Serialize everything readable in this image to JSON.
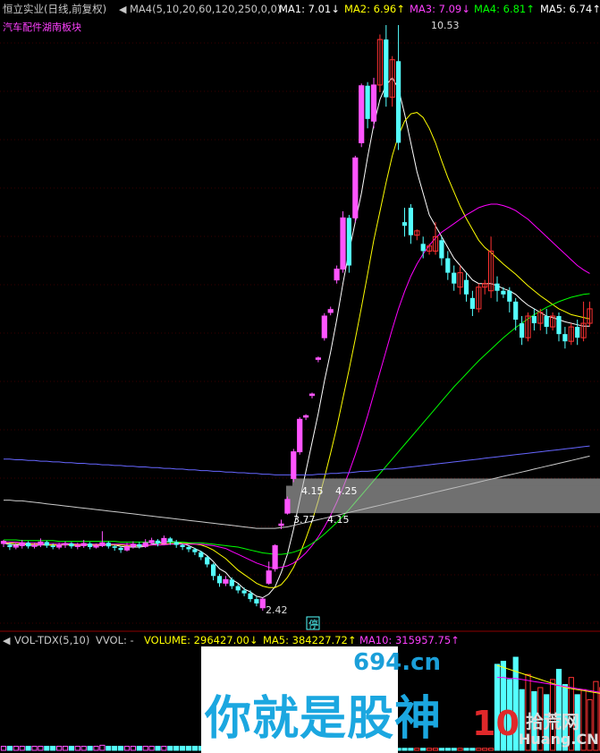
{
  "header": {
    "stock_name": "恒立实业(日线,前复权)",
    "ma_label": "MA4(5,10,20,60,120,250,0,0)",
    "ma1": "MA1: 7.01↓",
    "ma2": "MA2: 6.96↑",
    "ma3": "MA3: 7.09↓",
    "ma4": "MA4: 6.81↑",
    "ma5": "MA5: 6.74↑",
    "sector": "汽车配件湖南板块"
  },
  "annotations": {
    "high": "10.53",
    "low": "2.42",
    "gap1_left": "4.15",
    "gap1_right": "4.25",
    "gap2_left": "3.77",
    "gap2_right": "4.15",
    "halt": "停"
  },
  "volume_header": {
    "name": "VOL-TDX(5,10)",
    "vvol": "VVOL: -",
    "volume": "VOLUME: 296427.00↓",
    "ma5": "MA5: 384227.72↑",
    "ma10": "MA10: 315957.75↑"
  },
  "watermark": {
    "site1": "694.cn",
    "slogan": "你就是股神",
    "site2_num": "10",
    "site2_cn": "拾荒网",
    "site2_en": "Huang.CN"
  },
  "colors": {
    "up": "#ff55ff",
    "up_red": "#ff3232",
    "down": "#54ffff",
    "ma1": "#ffffff",
    "ma2": "#ffff00",
    "ma3": "#ff00ff",
    "ma4": "#00ff00",
    "ma5": "#6666ff",
    "ma6": "#cccccc",
    "header_title": "#c8c8c8",
    "header_ma1": "#ffffff",
    "header_ma2": "#ffff00",
    "header_ma3": "#ff40ff",
    "header_ma4": "#00ff00",
    "header_ma5": "#ffffff"
  },
  "chart_data": {
    "type": "candlestick",
    "price_axis": {
      "min": 2.42,
      "max": 10.53,
      "scale": "linear"
    },
    "extremes": {
      "high": 10.53,
      "low": 2.42
    },
    "gaps": [
      {
        "from": 4.15,
        "to": 4.25
      },
      {
        "from": 3.77,
        "to": 4.15
      }
    ],
    "candles": [
      [
        3.35,
        3.38,
        3.3,
        3.4
      ],
      [
        3.33,
        3.3,
        3.26,
        3.36
      ],
      [
        3.3,
        3.32,
        3.27,
        3.36
      ],
      [
        3.32,
        3.36,
        3.28,
        3.4
      ],
      [
        3.36,
        3.31,
        3.28,
        3.38
      ],
      [
        3.31,
        3.33,
        3.28,
        3.36
      ],
      [
        3.33,
        3.37,
        3.3,
        3.42
      ],
      [
        3.37,
        3.32,
        3.29,
        3.39
      ],
      [
        3.32,
        3.3,
        3.27,
        3.35
      ],
      [
        3.3,
        3.33,
        3.27,
        3.36
      ],
      [
        3.33,
        3.35,
        3.29,
        3.38
      ],
      [
        3.35,
        3.31,
        3.28,
        3.37
      ],
      [
        3.31,
        3.32,
        3.27,
        3.36
      ],
      [
        3.32,
        3.35,
        3.29,
        3.4
      ],
      [
        3.35,
        3.3,
        3.27,
        3.37
      ],
      [
        3.3,
        3.32,
        3.28,
        3.35
      ],
      [
        3.32,
        3.36,
        3.3,
        3.52
      ],
      [
        3.36,
        3.31,
        3.28,
        3.38
      ],
      [
        3.31,
        3.29,
        3.25,
        3.33
      ],
      [
        3.29,
        3.26,
        3.22,
        3.31
      ],
      [
        3.26,
        3.31,
        3.24,
        3.36
      ],
      [
        3.31,
        3.34,
        3.28,
        3.38
      ],
      [
        3.34,
        3.31,
        3.28,
        3.37
      ],
      [
        3.31,
        3.36,
        3.29,
        3.41
      ],
      [
        3.36,
        3.39,
        3.33,
        3.43
      ],
      [
        3.39,
        3.35,
        3.31,
        3.41
      ],
      [
        3.35,
        3.42,
        3.33,
        3.46
      ],
      [
        3.42,
        3.37,
        3.33,
        3.44
      ],
      [
        3.37,
        3.33,
        3.29,
        3.4
      ],
      [
        3.33,
        3.3,
        3.26,
        3.35
      ],
      [
        3.3,
        3.27,
        3.23,
        3.32
      ],
      [
        3.27,
        3.23,
        3.19,
        3.29
      ],
      [
        3.23,
        3.16,
        3.12,
        3.25
      ],
      [
        3.16,
        3.06,
        3.02,
        3.18
      ],
      [
        3.06,
        2.9,
        2.84,
        3.08
      ],
      [
        2.9,
        2.8,
        2.75,
        2.93
      ],
      [
        2.8,
        2.85,
        2.76,
        2.9
      ],
      [
        2.85,
        2.76,
        2.72,
        2.88
      ],
      [
        2.76,
        2.7,
        2.66,
        2.79
      ],
      [
        2.7,
        2.66,
        2.62,
        2.74
      ],
      [
        2.66,
        2.58,
        2.54,
        2.7
      ],
      [
        2.58,
        2.52,
        2.48,
        2.61
      ],
      [
        2.46,
        2.58,
        2.42,
        2.6
      ],
      [
        2.8,
        2.97,
        2.78,
        3.1
      ],
      [
        3.0,
        3.32,
        2.96,
        3.34
      ],
      [
        3.6,
        3.62,
        3.55,
        3.68
      ],
      [
        3.77,
        3.96,
        3.75,
        4.0
      ],
      [
        4.25,
        4.62,
        4.2,
        4.66
      ],
      [
        4.62,
        5.07,
        4.58,
        5.1
      ],
      [
        5.1,
        5.12,
        5.06,
        5.14
      ],
      [
        5.4,
        5.42,
        5.36,
        5.44
      ],
      [
        5.9,
        5.92,
        5.86,
        5.94
      ],
      [
        6.2,
        6.5,
        6.16,
        6.54
      ],
      [
        6.55,
        6.59,
        6.51,
        6.63
      ],
      [
        7.0,
        7.15,
        6.95,
        7.2
      ],
      [
        7.15,
        7.86,
        7.1,
        7.95
      ],
      [
        7.86,
        7.2,
        7.1,
        7.9
      ],
      [
        7.86,
        8.69,
        7.8,
        8.72
      ],
      [
        8.9,
        9.69,
        8.84,
        9.72
      ],
      [
        9.69,
        9.23,
        9.1,
        9.74
      ],
      [
        9.2,
        9.7,
        9.1,
        9.8
      ],
      [
        9.7,
        10.33,
        9.6,
        10.4
      ],
      [
        10.33,
        9.53,
        9.4,
        10.53
      ],
      [
        9.53,
        10.05,
        9.4,
        10.1
      ],
      [
        10.03,
        8.9,
        8.8,
        10.53
      ],
      [
        7.8,
        7.75,
        7.6,
        8.0
      ],
      [
        8.0,
        7.62,
        7.5,
        8.05
      ],
      [
        7.62,
        7.68,
        7.55,
        7.7
      ],
      [
        7.5,
        7.4,
        7.3,
        7.6
      ],
      [
        7.4,
        7.47,
        7.35,
        7.5
      ],
      [
        7.4,
        7.6,
        7.35,
        7.8
      ],
      [
        7.55,
        7.3,
        7.2,
        7.6
      ],
      [
        7.3,
        7.1,
        7.0,
        7.4
      ],
      [
        7.1,
        6.95,
        6.85,
        7.2
      ],
      [
        6.9,
        7.1,
        6.8,
        7.2
      ],
      [
        7.0,
        6.8,
        6.7,
        7.1
      ],
      [
        6.75,
        6.6,
        6.5,
        6.85
      ],
      [
        6.6,
        6.9,
        6.55,
        6.95
      ],
      [
        6.9,
        6.95,
        6.8,
        7.0
      ],
      [
        6.85,
        7.4,
        6.75,
        7.6
      ],
      [
        6.95,
        6.85,
        6.7,
        7.05
      ],
      [
        6.85,
        6.8,
        6.75,
        6.9
      ],
      [
        6.85,
        6.7,
        6.55,
        6.9
      ],
      [
        6.7,
        6.45,
        6.3,
        6.75
      ],
      [
        6.4,
        6.2,
        6.1,
        6.5
      ],
      [
        6.2,
        6.5,
        6.15,
        6.55
      ],
      [
        6.5,
        6.4,
        6.3,
        6.6
      ],
      [
        6.4,
        6.55,
        6.3,
        6.6
      ],
      [
        6.5,
        6.35,
        6.25,
        6.6
      ],
      [
        6.35,
        6.5,
        6.3,
        6.55
      ],
      [
        6.5,
        6.25,
        6.15,
        6.55
      ],
      [
        6.25,
        6.15,
        6.05,
        6.35
      ],
      [
        6.15,
        6.35,
        6.1,
        6.4
      ],
      [
        6.35,
        6.2,
        6.1,
        6.45
      ],
      [
        6.2,
        6.4,
        6.15,
        6.7
      ],
      [
        6.4,
        6.6,
        6.35,
        6.7
      ]
    ],
    "ma_series": [
      {
        "name": "MA1",
        "values": [
          3.35,
          3.34,
          3.33,
          3.34,
          3.33,
          3.32,
          3.33,
          3.33,
          3.33,
          3.33,
          3.34,
          3.33,
          3.32,
          3.33,
          3.33,
          3.32,
          3.33,
          3.33,
          3.33,
          3.31,
          3.3,
          3.3,
          3.3,
          3.31,
          3.34,
          3.35,
          3.37,
          3.38,
          3.37,
          3.35,
          3.32,
          3.28,
          3.24,
          3.18,
          3.1,
          3.0,
          2.95,
          2.85,
          2.8,
          2.72,
          2.68,
          2.62,
          2.6,
          2.65,
          2.75,
          2.95,
          3.2,
          3.55,
          3.95,
          4.35,
          4.75,
          5.15,
          5.6,
          6.0,
          6.45,
          6.95,
          7.4,
          7.8,
          8.2,
          8.7,
          9.15,
          9.5,
          9.7,
          9.8,
          9.65,
          9.3,
          8.9,
          8.5,
          8.2,
          7.9,
          7.75,
          7.6,
          7.45,
          7.3,
          7.2,
          7.1,
          7.0,
          6.95,
          6.95,
          6.95,
          6.92,
          6.88,
          6.85,
          6.8,
          6.72,
          6.65,
          6.6,
          6.55,
          6.5,
          6.48,
          6.45,
          6.42,
          6.4,
          6.38,
          6.36,
          6.36
        ]
      },
      {
        "name": "MA2",
        "values": [
          3.36,
          3.36,
          3.35,
          3.35,
          3.34,
          3.34,
          3.34,
          3.33,
          3.33,
          3.33,
          3.33,
          3.33,
          3.33,
          3.33,
          3.33,
          3.33,
          3.33,
          3.33,
          3.33,
          3.33,
          3.32,
          3.32,
          3.32,
          3.32,
          3.33,
          3.33,
          3.34,
          3.35,
          3.35,
          3.35,
          3.35,
          3.34,
          3.33,
          3.3,
          3.26,
          3.2,
          3.14,
          3.06,
          2.98,
          2.92,
          2.86,
          2.8,
          2.76,
          2.74,
          2.74,
          2.78,
          2.88,
          3.02,
          3.2,
          3.42,
          3.66,
          3.94,
          4.26,
          4.6,
          4.96,
          5.36,
          5.76,
          6.18,
          6.62,
          7.08,
          7.55,
          7.95,
          8.35,
          8.72,
          9.0,
          9.2,
          9.3,
          9.32,
          9.25,
          9.1,
          8.9,
          8.65,
          8.42,
          8.22,
          8.02,
          7.85,
          7.7,
          7.55,
          7.45,
          7.38,
          7.3,
          7.22,
          7.15,
          7.08,
          7.0,
          6.92,
          6.85,
          6.78,
          6.72,
          6.66,
          6.6,
          6.56,
          6.52,
          6.5,
          6.48,
          6.46
        ]
      },
      {
        "name": "MA3",
        "values": [
          3.37,
          3.37,
          3.37,
          3.36,
          3.36,
          3.36,
          3.35,
          3.35,
          3.35,
          3.35,
          3.35,
          3.35,
          3.34,
          3.34,
          3.34,
          3.34,
          3.34,
          3.34,
          3.34,
          3.34,
          3.34,
          3.34,
          3.33,
          3.33,
          3.33,
          3.33,
          3.33,
          3.34,
          3.34,
          3.34,
          3.34,
          3.34,
          3.34,
          3.33,
          3.32,
          3.3,
          3.28,
          3.24,
          3.2,
          3.16,
          3.12,
          3.08,
          3.05,
          3.02,
          3.01,
          3.02,
          3.04,
          3.08,
          3.14,
          3.22,
          3.32,
          3.44,
          3.58,
          3.74,
          3.92,
          4.12,
          4.34,
          4.58,
          4.84,
          5.12,
          5.42,
          5.72,
          6.02,
          6.32,
          6.6,
          6.84,
          7.05,
          7.22,
          7.36,
          7.48,
          7.58,
          7.66,
          7.72,
          7.78,
          7.84,
          7.9,
          7.95,
          8.0,
          8.03,
          8.05,
          8.05,
          8.03,
          8.0,
          7.96,
          7.9,
          7.84,
          7.76,
          7.68,
          7.6,
          7.52,
          7.44,
          7.36,
          7.28,
          7.2,
          7.14,
          7.09
        ]
      },
      {
        "name": "MA4",
        "values": [
          3.4,
          3.4,
          3.4,
          3.39,
          3.39,
          3.39,
          3.39,
          3.39,
          3.39,
          3.38,
          3.38,
          3.38,
          3.38,
          3.38,
          3.38,
          3.38,
          3.38,
          3.38,
          3.38,
          3.37,
          3.37,
          3.37,
          3.37,
          3.37,
          3.37,
          3.37,
          3.37,
          3.37,
          3.37,
          3.37,
          3.36,
          3.36,
          3.36,
          3.35,
          3.34,
          3.33,
          3.32,
          3.31,
          3.3,
          3.28,
          3.26,
          3.24,
          3.22,
          3.21,
          3.2,
          3.2,
          3.21,
          3.23,
          3.26,
          3.3,
          3.35,
          3.41,
          3.48,
          3.56,
          3.64,
          3.73,
          3.82,
          3.92,
          4.02,
          4.12,
          4.22,
          4.32,
          4.42,
          4.52,
          4.62,
          4.72,
          4.82,
          4.92,
          5.02,
          5.12,
          5.22,
          5.32,
          5.42,
          5.52,
          5.61,
          5.7,
          5.79,
          5.88,
          5.96,
          6.04,
          6.12,
          6.2,
          6.27,
          6.34,
          6.4,
          6.46,
          6.52,
          6.57,
          6.62,
          6.66,
          6.7,
          6.73,
          6.76,
          6.78,
          6.8,
          6.81
        ]
      },
      {
        "name": "MA5",
        "values": [
          4.52,
          4.52,
          4.51,
          4.51,
          4.5,
          4.5,
          4.49,
          4.49,
          4.48,
          4.48,
          4.47,
          4.47,
          4.46,
          4.46,
          4.45,
          4.45,
          4.44,
          4.44,
          4.43,
          4.43,
          4.42,
          4.42,
          4.41,
          4.41,
          4.4,
          4.4,
          4.39,
          4.39,
          4.38,
          4.38,
          4.37,
          4.37,
          4.36,
          4.36,
          4.35,
          4.35,
          4.34,
          4.34,
          4.33,
          4.33,
          4.32,
          4.32,
          4.31,
          4.31,
          4.3,
          4.3,
          4.3,
          4.3,
          4.3,
          4.3,
          4.3,
          4.31,
          4.31,
          4.32,
          4.32,
          4.33,
          4.33,
          4.34,
          4.35,
          4.35,
          4.36,
          4.37,
          4.38,
          4.38,
          4.39,
          4.4,
          4.41,
          4.42,
          4.43,
          4.44,
          4.45,
          4.46,
          4.47,
          4.48,
          4.49,
          4.5,
          4.51,
          4.52,
          4.53,
          4.54,
          4.55,
          4.56,
          4.57,
          4.58,
          4.59,
          4.6,
          4.61,
          4.62,
          4.63,
          4.64,
          4.65,
          4.66,
          4.67,
          4.68,
          4.69,
          4.7
        ]
      },
      {
        "name": "MA6",
        "values": [
          3.95,
          3.95,
          3.94,
          3.94,
          3.93,
          3.92,
          3.91,
          3.9,
          3.89,
          3.88,
          3.87,
          3.86,
          3.85,
          3.84,
          3.83,
          3.82,
          3.81,
          3.8,
          3.79,
          3.78,
          3.77,
          3.76,
          3.75,
          3.74,
          3.73,
          3.72,
          3.71,
          3.7,
          3.69,
          3.68,
          3.67,
          3.66,
          3.65,
          3.64,
          3.63,
          3.62,
          3.61,
          3.6,
          3.59,
          3.58,
          3.57,
          3.56,
          3.56,
          3.56,
          3.56,
          3.57,
          3.58,
          3.6,
          3.62,
          3.64,
          3.66,
          3.68,
          3.7,
          3.72,
          3.74,
          3.76,
          3.78,
          3.8,
          3.82,
          3.84,
          3.86,
          3.88,
          3.9,
          3.92,
          3.94,
          3.96,
          3.98,
          4.0,
          4.02,
          4.04,
          4.06,
          4.08,
          4.1,
          4.12,
          4.14,
          4.16,
          4.18,
          4.2,
          4.22,
          4.24,
          4.26,
          4.28,
          4.3,
          4.32,
          4.34,
          4.36,
          4.38,
          4.4,
          4.42,
          4.44,
          4.46,
          4.48,
          4.5,
          4.52,
          4.54,
          4.56
        ]
      }
    ],
    "volume": [
      4,
      4,
      4,
      4,
      4,
      4,
      4,
      4,
      4,
      4,
      4,
      4,
      4,
      4,
      4,
      4,
      5,
      4,
      4,
      4,
      4,
      4,
      4,
      4,
      4,
      4,
      4,
      4,
      4,
      4,
      4,
      4,
      4,
      4,
      4,
      4,
      4,
      4,
      4,
      4,
      4,
      4,
      2,
      6,
      8,
      2,
      2,
      2,
      2,
      2,
      2,
      2,
      2,
      2,
      2,
      2,
      2,
      2,
      2,
      2,
      2,
      2,
      2,
      2,
      2,
      2,
      2,
      2,
      2,
      2,
      2,
      2,
      2,
      2,
      2,
      2,
      2,
      2,
      2,
      2,
      85,
      88,
      70,
      92,
      60,
      75,
      58,
      62,
      55,
      70,
      80,
      65,
      72,
      55,
      60,
      50,
      68,
      62,
      58,
      48,
      70,
      40,
      50,
      45
    ],
    "volume_ma5": [
      84,
      82,
      80,
      78,
      76,
      74,
      72,
      70,
      68,
      66,
      64,
      62,
      61,
      60,
      59,
      58,
      57,
      56,
      55,
      55,
      54,
      53,
      52,
      50
    ],
    "volume_ma10": [
      72,
      72,
      71,
      71,
      70,
      69,
      68,
      67,
      66,
      65,
      64,
      63,
      62,
      61,
      60,
      59,
      58,
      57,
      56,
      55,
      54,
      53,
      52,
      51
    ]
  }
}
